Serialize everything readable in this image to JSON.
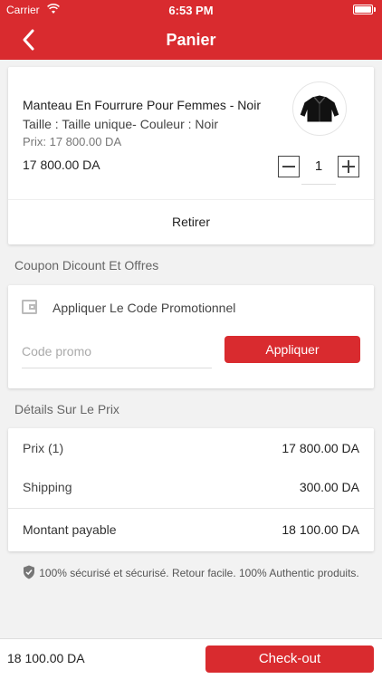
{
  "status_bar": {
    "carrier": "Carrier",
    "time": "6:53 PM"
  },
  "header": {
    "title": "Panier"
  },
  "product": {
    "name": "Manteau En Fourrure Pour Femmes - Noir",
    "attributes": "Taille : Taille unique- Couleur : Noir",
    "unit_price": "Prix: 17 800.00 DA",
    "total": "17 800.00 DA",
    "quantity": "1",
    "image_icon": "coat-icon",
    "remove_label": "Retirer"
  },
  "coupon": {
    "section_label": "Coupon Dicount Et Offres",
    "title": "Appliquer Le Code Promotionnel",
    "input_placeholder": "Code promo",
    "apply_label": "Appliquer"
  },
  "price_details": {
    "section_label": "Détails Sur Le Prix",
    "rows": [
      {
        "label": "Prix (1)",
        "value": "17 800.00 DA"
      },
      {
        "label": "Shipping",
        "value": "300.00 DA"
      },
      {
        "label": "Montant payable",
        "value": "18 100.00 DA"
      }
    ]
  },
  "secure_note": "100% sécurisé et sécurisé. Retour facile. 100% Authentic produits.",
  "footer": {
    "total": "18 100.00 DA",
    "checkout_label": "Check-out"
  },
  "colors": {
    "accent": "#d92b2f",
    "background": "#f2f2f2"
  }
}
